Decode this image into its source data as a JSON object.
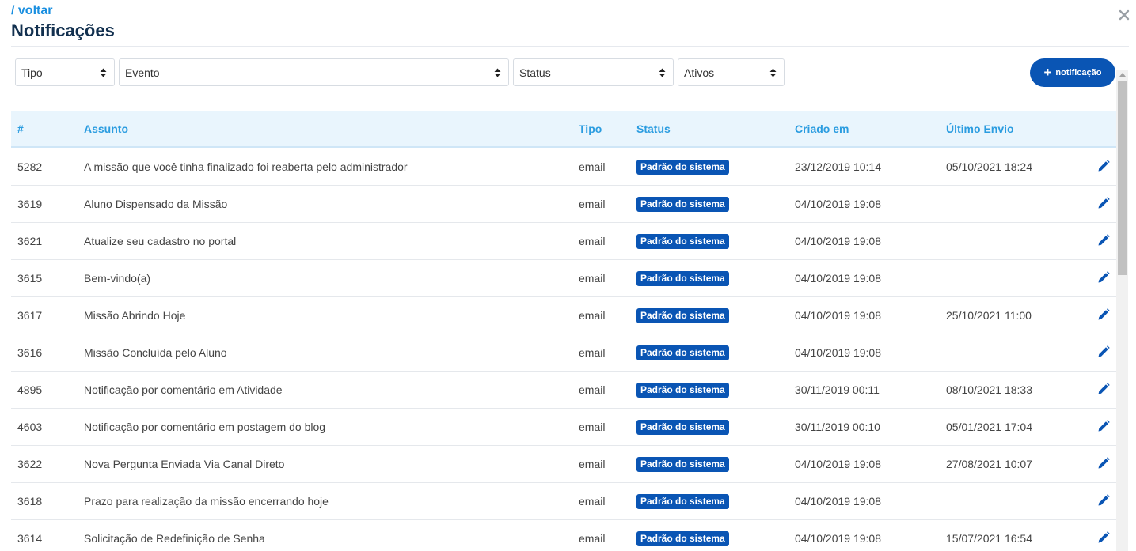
{
  "header": {
    "back_label": "/ voltar",
    "title": "Notificações"
  },
  "filters": {
    "tipo": "Tipo",
    "evento": "Evento",
    "status": "Status",
    "ativos": "Ativos"
  },
  "new_button": {
    "label": "notificação"
  },
  "table": {
    "headers": {
      "id": "#",
      "assunto": "Assunto",
      "tipo": "Tipo",
      "status": "Status",
      "criado": "Criado em",
      "envio": "Último Envio"
    },
    "rows": [
      {
        "id": "5282",
        "assunto": "A missão que você tinha finalizado foi reaberta pelo administrador",
        "tipo": "email",
        "status": "Padrão do sistema",
        "criado": "23/12/2019 10:14",
        "envio": "05/10/2021 18:24"
      },
      {
        "id": "3619",
        "assunto": "Aluno Dispensado da Missão",
        "tipo": "email",
        "status": "Padrão do sistema",
        "criado": "04/10/2019 19:08",
        "envio": ""
      },
      {
        "id": "3621",
        "assunto": "Atualize seu cadastro no portal",
        "tipo": "email",
        "status": "Padrão do sistema",
        "criado": "04/10/2019 19:08",
        "envio": ""
      },
      {
        "id": "3615",
        "assunto": "Bem-vindo(a)",
        "tipo": "email",
        "status": "Padrão do sistema",
        "criado": "04/10/2019 19:08",
        "envio": ""
      },
      {
        "id": "3617",
        "assunto": "Missão Abrindo Hoje",
        "tipo": "email",
        "status": "Padrão do sistema",
        "criado": "04/10/2019 19:08",
        "envio": "25/10/2021 11:00"
      },
      {
        "id": "3616",
        "assunto": "Missão Concluída pelo Aluno",
        "tipo": "email",
        "status": "Padrão do sistema",
        "criado": "04/10/2019 19:08",
        "envio": ""
      },
      {
        "id": "4895",
        "assunto": "Notificação por comentário em Atividade",
        "tipo": "email",
        "status": "Padrão do sistema",
        "criado": "30/11/2019 00:11",
        "envio": "08/10/2021 18:33"
      },
      {
        "id": "4603",
        "assunto": "Notificação por comentário em postagem do blog",
        "tipo": "email",
        "status": "Padrão do sistema",
        "criado": "30/11/2019 00:10",
        "envio": "05/01/2021 17:04"
      },
      {
        "id": "3622",
        "assunto": "Nova Pergunta Enviada Via Canal Direto",
        "tipo": "email",
        "status": "Padrão do sistema",
        "criado": "04/10/2019 19:08",
        "envio": "27/08/2021 10:07"
      },
      {
        "id": "3618",
        "assunto": "Prazo para realização da missão encerrando hoje",
        "tipo": "email",
        "status": "Padrão do sistema",
        "criado": "04/10/2019 19:08",
        "envio": ""
      },
      {
        "id": "3614",
        "assunto": "Solicitação de Redefinição de Senha",
        "tipo": "email",
        "status": "Padrão do sistema",
        "criado": "04/10/2019 19:08",
        "envio": "15/07/2021 16:54"
      }
    ]
  },
  "colors": {
    "accent": "#0a55b4",
    "header_text": "#2a9ce0",
    "header_bg": "#e9f5fd",
    "title": "#12304f"
  },
  "icons": {
    "close": "close-icon",
    "caret": "sort-caret-icon",
    "edit": "pencil-icon",
    "add": "plus-icon"
  }
}
